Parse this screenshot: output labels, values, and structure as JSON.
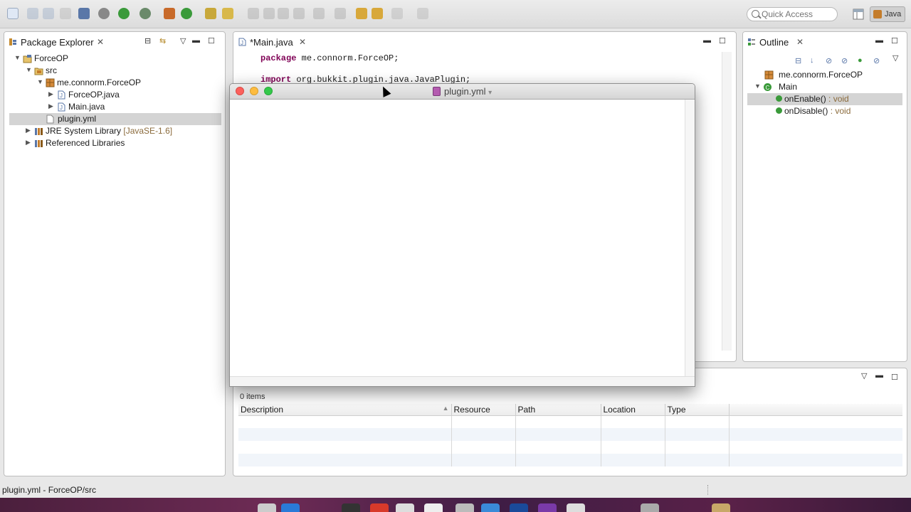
{
  "package_explorer": {
    "title": "Package Explorer",
    "tree": [
      {
        "label": "ForceOP",
        "decoration": ""
      },
      {
        "label": "src",
        "decoration": ""
      },
      {
        "label": "me.connorm.ForceOP",
        "decoration": ""
      },
      {
        "label": "ForceOP.java",
        "decoration": ""
      },
      {
        "label": "Main.java",
        "decoration": ""
      },
      {
        "label": "plugin.yml",
        "decoration": ""
      },
      {
        "label": "JRE System Library",
        "decoration": "[JavaSE-1.6]"
      },
      {
        "label": "Referenced Libraries",
        "decoration": ""
      }
    ]
  },
  "editor": {
    "tab_label": "*Main.java",
    "lines": [
      {
        "keyword": "package",
        "rest": " me.connorm.ForceOP;"
      },
      {
        "keyword": "import",
        "rest": " org.bukkit.plugin.java.JavaPlugin;"
      }
    ]
  },
  "floating_window": {
    "title": "plugin.yml",
    "title_suffix": "▾"
  },
  "outline": {
    "title": "Outline",
    "items": [
      {
        "label": "me.connorm.ForceOP",
        "type": ""
      },
      {
        "label": "Main",
        "type": ""
      },
      {
        "label": "onEnable()",
        "type": " : void"
      },
      {
        "label": "onDisable()",
        "type": " : void"
      }
    ]
  },
  "problems": {
    "count": "0 items",
    "columns": [
      "Description",
      "Resource",
      "Path",
      "Location",
      "Type"
    ]
  },
  "quick_access": {
    "placeholder": "Quick Access"
  },
  "perspective": {
    "label": "Java"
  },
  "status_bar": {
    "text": "plugin.yml - ForceOP/src"
  },
  "colors": {
    "keyword": "#7f0055",
    "selection": "#d4d4d4",
    "close_light": "#fc605c",
    "minimize_light": "#fdbc40",
    "zoom_light": "#34c84a"
  }
}
